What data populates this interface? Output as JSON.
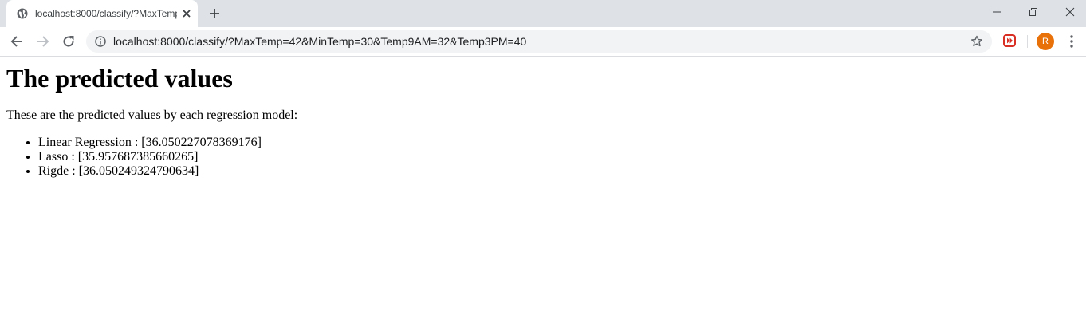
{
  "browser": {
    "tab": {
      "title": "localhost:8000/classify/?MaxTemp=42&MinTemp=30&Temp9AM=32&Temp3PM=40",
      "favicon": "globe-icon",
      "close_icon": "close-icon"
    },
    "new_tab_icon": "plus-icon",
    "window_controls": [
      "minimize-icon",
      "restore-icon",
      "close-icon"
    ],
    "toolbar": {
      "back_icon": "back-arrow-icon",
      "forward_icon": "forward-arrow-icon",
      "reload_icon": "reload-icon",
      "url": "localhost:8000/classify/?MaxTemp=42&MinTemp=30&Temp9AM=32&Temp3PM=40",
      "site_info_icon": "info-icon",
      "bookmark_icon": "star-icon",
      "extension_icon": "extension-icon",
      "avatar_letter": "R",
      "menu_icon": "kebab-menu-icon"
    },
    "colors": {
      "tabstrip": "#dee1e6",
      "omnibox": "#f1f3f4",
      "avatar": "#e8710a",
      "extension": "#d93025"
    }
  },
  "page": {
    "heading": "The predicted values",
    "intro": "These are the predicted values by each regression model:",
    "predictions": [
      "Linear Regression : [36.050227078369176]",
      "Lasso : [35.957687385660265]",
      "Rigde : [36.050249324790634]"
    ]
  }
}
